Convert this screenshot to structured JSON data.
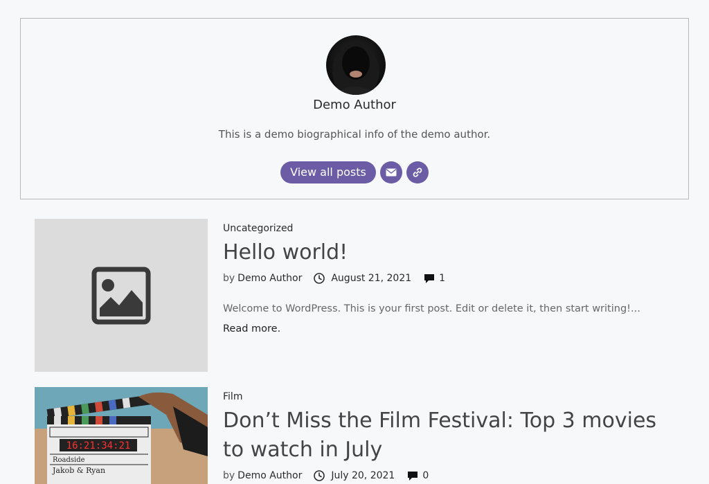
{
  "author": {
    "name": "Demo Author",
    "bio": "This is a demo biographical info of the demo author.",
    "view_all_label": "View all posts",
    "email_icon": "mail-icon",
    "website_icon": "link-icon"
  },
  "posts": [
    {
      "category": "Uncategorized",
      "title": "Hello world!",
      "by_label": "by",
      "author": "Demo Author",
      "date": "August 21, 2021",
      "comments": "1",
      "excerpt": "Welcome to WordPress. This is your first post. Edit or delete it, then start writing!...",
      "read_more": "Read more.",
      "thumbnail_icon": "image-placeholder-icon"
    },
    {
      "category": "Film",
      "title": "Don’t Miss the Film Festival: Top 3 movies to watch in July",
      "by_label": "by",
      "author": "Demo Author",
      "date": "July 20, 2021",
      "comments": "0",
      "thumbnail": {
        "clapper_time": "16:21:34:21",
        "clapper_row1": "Roadside",
        "clapper_row2": "Jakob & Ryan"
      }
    }
  ],
  "colors": {
    "accent": "#6b5ca5",
    "background": "#f7f8fa",
    "placeholder": "#dcdcdc"
  }
}
